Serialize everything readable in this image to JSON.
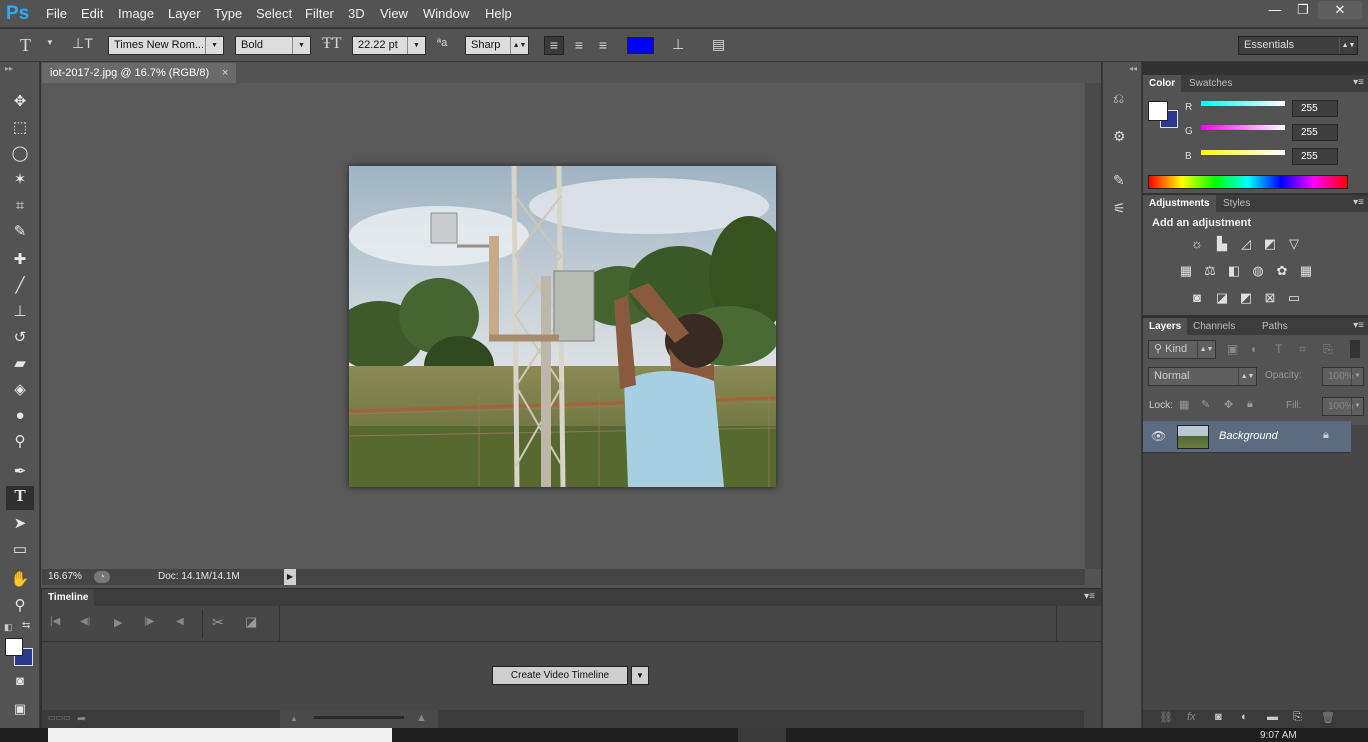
{
  "app": {
    "logo": "Ps"
  },
  "menu": [
    "File",
    "Edit",
    "Image",
    "Layer",
    "Type",
    "Select",
    "Filter",
    "3D",
    "View",
    "Window",
    "Help"
  ],
  "window_controls": {
    "minimize": "—",
    "restore": "❐",
    "close": "✕"
  },
  "options": {
    "font_family": "Times New Rom...",
    "font_style": "Bold",
    "font_size": "22.22 pt",
    "antialias": "Sharp",
    "text_color": "#0000ff",
    "workspace": "Essentials"
  },
  "document": {
    "tab_title": "iot-2017-2.jpg @ 16.7% (RGB/8)",
    "close": "×",
    "zoom": "16.67%",
    "doc_info": "Doc: 14.1M/14.1M"
  },
  "timeline": {
    "title": "Timeline",
    "create_button": "Create Video Timeline"
  },
  "color_panel": {
    "tabs": [
      "Color",
      "Swatches"
    ],
    "channels": [
      {
        "label": "R",
        "value": "255"
      },
      {
        "label": "G",
        "value": "255"
      },
      {
        "label": "B",
        "value": "255"
      }
    ],
    "foreground": "#ffffff",
    "background": "#2b3a8f"
  },
  "adjustments_panel": {
    "tabs": [
      "Adjustments",
      "Styles"
    ],
    "heading": "Add an adjustment"
  },
  "layers_panel": {
    "tabs": [
      "Layers",
      "Channels",
      "Paths"
    ],
    "filter_kind": "Kind",
    "blend_mode": "Normal",
    "opacity_label": "Opacity:",
    "opacity_value": "100%",
    "lock_label": "Lock:",
    "fill_label": "Fill:",
    "fill_value": "100%",
    "layers": [
      {
        "name": "Background"
      }
    ]
  },
  "taskbar": {
    "clock": "9:07 AM"
  }
}
